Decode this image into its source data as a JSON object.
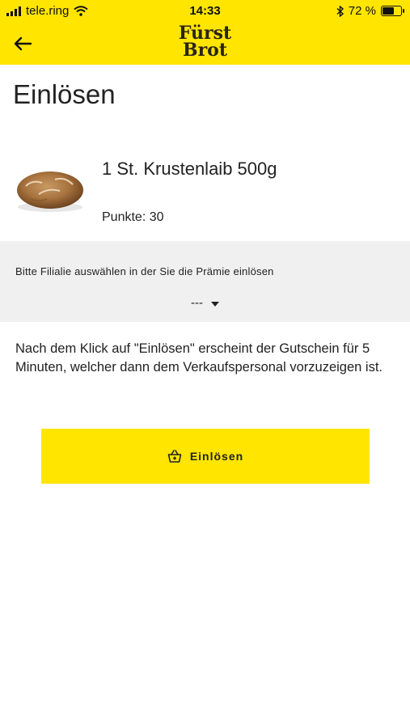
{
  "status_bar": {
    "carrier": "tele.ring",
    "time": "14:33",
    "battery_percent": "72 %",
    "battery_level": 0.72
  },
  "header": {
    "logo_line1": "Fürst",
    "logo_line2": "Brot",
    "back_icon": "arrow-left-icon",
    "accent_color": "#FFE500"
  },
  "page": {
    "title": "Einlösen"
  },
  "product": {
    "name": "1 St. Krustenlaib 500g",
    "points": "Punkte: 30"
  },
  "branch_select": {
    "label": "Bitte Filialie auswählen in der Sie die Prämie einlösen",
    "selected": "---"
  },
  "info_text": "Nach dem Klick auf \"Einlösen\" erscheint der Gutschein für 5 Minuten, welcher dann dem Verkaufspersonal vorzuzeigen ist.",
  "redeem_button": {
    "label": "Einlösen",
    "icon": "basket-icon"
  }
}
